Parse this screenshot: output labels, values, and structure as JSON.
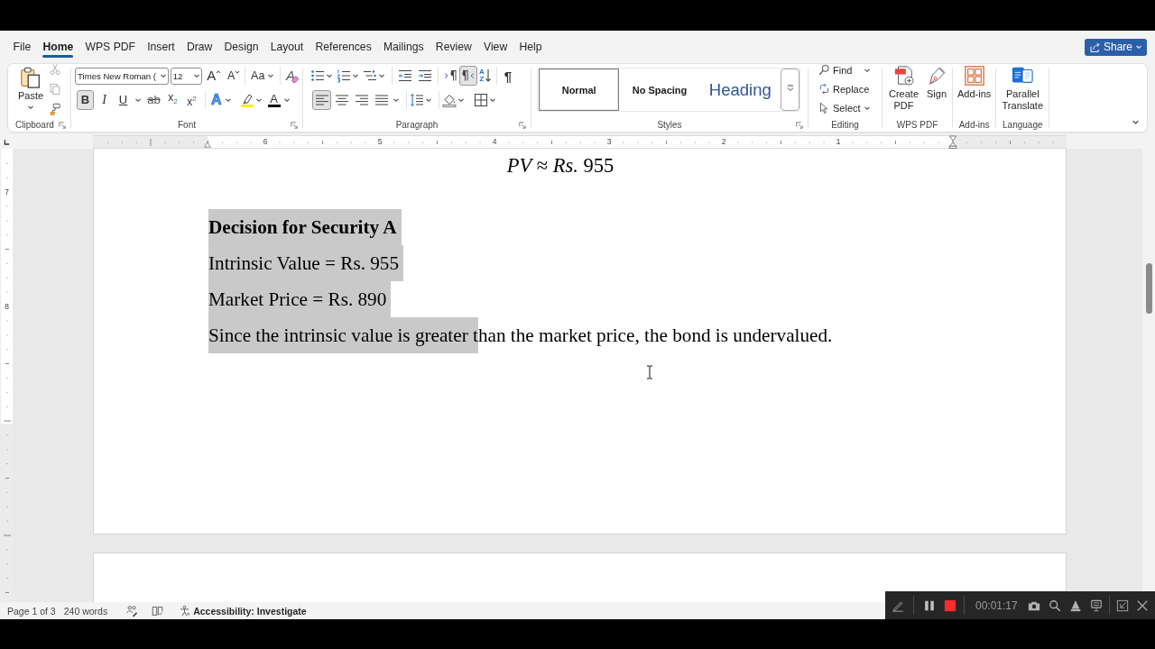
{
  "tabs": [
    {
      "label": "File",
      "selected": false
    },
    {
      "label": "Home",
      "selected": true
    },
    {
      "label": "WPS PDF",
      "selected": false
    },
    {
      "label": "Insert",
      "selected": false
    },
    {
      "label": "Draw",
      "selected": false
    },
    {
      "label": "Design",
      "selected": false
    },
    {
      "label": "Layout",
      "selected": false
    },
    {
      "label": "References",
      "selected": false
    },
    {
      "label": "Mailings",
      "selected": false
    },
    {
      "label": "Review",
      "selected": false
    },
    {
      "label": "View",
      "selected": false
    },
    {
      "label": "Help",
      "selected": false
    }
  ],
  "share_button": {
    "label": "Share"
  },
  "ribbon": {
    "clipboard": {
      "label": "Clipboard",
      "paste": "Paste",
      "cut_disabled": true,
      "copy_disabled": true
    },
    "font": {
      "label": "Font",
      "font_name": "Times New Roman (",
      "font_size": "12",
      "grow": "A",
      "shrink": "A",
      "change_case": "Aa",
      "clear": "A",
      "toggles": [
        {
          "kind": "bold",
          "glyph": "B",
          "selected": true
        },
        {
          "kind": "italic",
          "glyph": "I",
          "selected": false
        },
        {
          "kind": "underline",
          "glyph": "U",
          "selected": false
        },
        {
          "kind": "strikethrough",
          "glyph": "ab",
          "selected": false
        },
        {
          "kind": "subscript",
          "glyph": "x$_{2}$",
          "selected": false
        },
        {
          "kind": "superscript",
          "glyph": "x$^{2}$",
          "selected": false
        }
      ],
      "text_effects": "A",
      "font_color": "A"
    },
    "paragraph": {
      "label": "Paragraph",
      "direction": [
        {
          "kind": "ltr",
          "selected": false
        },
        {
          "kind": "rtl",
          "selected": true
        }
      ],
      "sort": [
        "A",
        "Z"
      ],
      "show_marks": "¶",
      "alignment": [
        {
          "kind": "left",
          "selected": true
        },
        {
          "kind": "center",
          "selected": false
        },
        {
          "kind": "right",
          "selected": false
        },
        {
          "kind": "justify",
          "selected": false
        }
      ]
    },
    "styles": {
      "label": "Styles",
      "items": [
        {
          "name": "Normal",
          "kind": "body",
          "selected": true
        },
        {
          "name": "No Spacing",
          "kind": "body",
          "selected": false
        },
        {
          "name": "Heading",
          "kind": "heading",
          "selected": false
        }
      ]
    },
    "editing": {
      "label": "Editing",
      "items": [
        {
          "kind": "find",
          "label": "Find",
          "dropdown": true
        },
        {
          "kind": "replace",
          "label": "Replace",
          "dropdown": false
        },
        {
          "kind": "select",
          "label": "Select",
          "dropdown": true
        }
      ]
    },
    "button_groups": [
      {
        "label": "WPS PDF",
        "buttons": [
          {
            "kind": "create_pdf",
            "label": "Create PDF"
          },
          {
            "kind": "sign",
            "label": "Sign"
          }
        ]
      },
      {
        "label": "Add-ins",
        "buttons": [
          {
            "kind": "add_ins",
            "label": "Add-ins"
          }
        ]
      },
      {
        "label": "Language",
        "buttons": [
          {
            "kind": "translate",
            "label": "Parallel Translate"
          }
        ]
      }
    ]
  },
  "ruler": {
    "numbers": [
      "6",
      "5",
      "4",
      "3",
      "2",
      "1"
    ]
  },
  "vertical_ruler": {
    "numbers": [
      "7",
      "8"
    ]
  },
  "document": {
    "paragraphs": [
      {
        "kind": "math",
        "segments": [
          {
            "text": "*PV* ≈ *Rs.* 955",
            "selected": false
          }
        ]
      },
      {
        "kind": "heading",
        "segments": [
          {
            "text": "Decision for Security A",
            "selected": true
          }
        ]
      },
      {
        "kind": "body",
        "segments": [
          {
            "text": "Intrinsic Value = Rs. 955",
            "selected": true
          }
        ]
      },
      {
        "kind": "body",
        "segments": [
          {
            "text": "Market Price = Rs. 890",
            "selected": true
          }
        ]
      },
      {
        "kind": "body",
        "segments": [
          {
            "text": "Since the intrinsic value is greater t",
            "selected": true
          },
          {
            "text": "han the market price, the bond is undervalued.",
            "selected": false
          }
        ]
      }
    ]
  },
  "status_bar": {
    "page": "Page 1 of 3",
    "words": "240 words",
    "accessibility": "Accessibility: Investigate"
  },
  "recorder": {
    "time": "00:01:17"
  }
}
